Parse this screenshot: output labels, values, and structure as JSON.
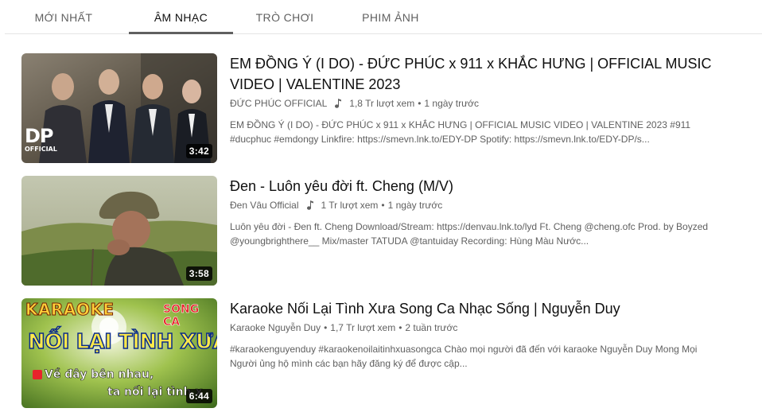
{
  "tabs": [
    {
      "label": "MỚI NHẤT",
      "active": false
    },
    {
      "label": "ÂM NHẠC",
      "active": true
    },
    {
      "label": "TRÒ CHƠI",
      "active": false
    },
    {
      "label": "PHIM ẢNH",
      "active": false
    }
  ],
  "videos": [
    {
      "title": "EM ĐỒNG Ý (I DO) - ĐỨC PHÚC x 911 x KHẮC HƯNG | OFFICIAL MUSIC VIDEO | VALENTINE 2023",
      "channel": "ĐỨC PHÚC OFFICIAL",
      "channel_icon": "music-note-icon",
      "views": "1,8 Tr lượt xem",
      "age": "1 ngày trước",
      "description": "EM ĐỒNG Ý (I DO) - ĐỨC PHÚC x 911 x KHẮC HƯNG | OFFICIAL MUSIC VIDEO | VALENTINE 2023 #911 #ducphuc #emdongy Linkfire: https://smevn.lnk.to/EDY-DP Spotify: https://smevn.lnk.to/EDY-DP/s...",
      "duration": "3:42",
      "thumb_logo": "DP",
      "thumb_logo_sub": "OFFICIAL"
    },
    {
      "title": "Đen - Luôn yêu đời ft. Cheng (M/V)",
      "channel": "Đen Vâu Official",
      "channel_icon": "music-note-icon",
      "views": "1 Tr lượt xem",
      "age": "1 ngày trước",
      "description": "Luôn yêu đời - Đen ft. Cheng Download/Stream: https://denvau.lnk.to/lyd Ft. Cheng @cheng.ofc Prod. by Boyzed @youngbrighthere__ Mix/master TATUDA @tantuiday Recording: Hùng Màu Nước...",
      "duration": "3:58"
    },
    {
      "title": "Karaoke Nối Lại Tình Xưa Song Ca Nhạc Sống | Nguyễn Duy",
      "channel": "Karaoke Nguyễn Duy",
      "views": "1,7 Tr lượt xem",
      "age": "2 tuần trước",
      "description": "#karaokenguyenduy #karaokenoilaitinhxuasongca Chào mọi người đã đến với karaoke Nguyễn Duy Mong Mọi Người ủng hộ mình các bạn hãy đăng ký để được cập...",
      "duration": "6:44",
      "thumb_karaoke": "KARAOKE",
      "thumb_songca": "SONG CA",
      "thumb_song_title": "NỐI LẠI TÌNH XƯA",
      "thumb_lyric_1": "Về đây bên nhau,",
      "thumb_lyric_2": "ta nối lại tình x"
    }
  ],
  "separator": "•",
  "colors": {
    "text_primary": "#0f0f0f",
    "text_secondary": "#606060",
    "tab_underline": "#606060",
    "divider": "#e5e5e5"
  }
}
